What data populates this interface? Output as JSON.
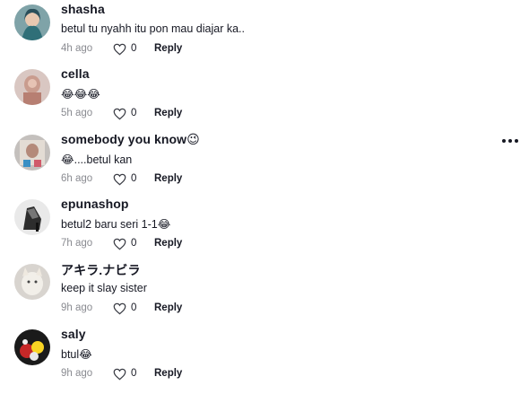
{
  "icons": {
    "like": "heart-outline-icon",
    "more": "more-dots-icon"
  },
  "comments": [
    {
      "username": "shasha",
      "text": "betul tu nyahh itu pon mau diajar ka..",
      "time": "4h ago",
      "likes": "0",
      "reply": "Reply"
    },
    {
      "username": "cella",
      "text": "😂😂😂",
      "time": "5h ago",
      "likes": "0",
      "reply": "Reply"
    },
    {
      "username": "somebody you know😉",
      "text": "😂....betul kan",
      "time": "6h ago",
      "likes": "0",
      "reply": "Reply"
    },
    {
      "username": "epunashop",
      "text": "betul2 baru seri 1-1😂",
      "time": "7h ago",
      "likes": "0",
      "reply": "Reply"
    },
    {
      "username": "アキラ.ナビラ",
      "text": "keep it slay sister",
      "time": "9h ago",
      "likes": "0",
      "reply": "Reply"
    },
    {
      "username": "saly",
      "text": "btul😂",
      "time": "9h ago",
      "likes": "0",
      "reply": "Reply"
    }
  ]
}
